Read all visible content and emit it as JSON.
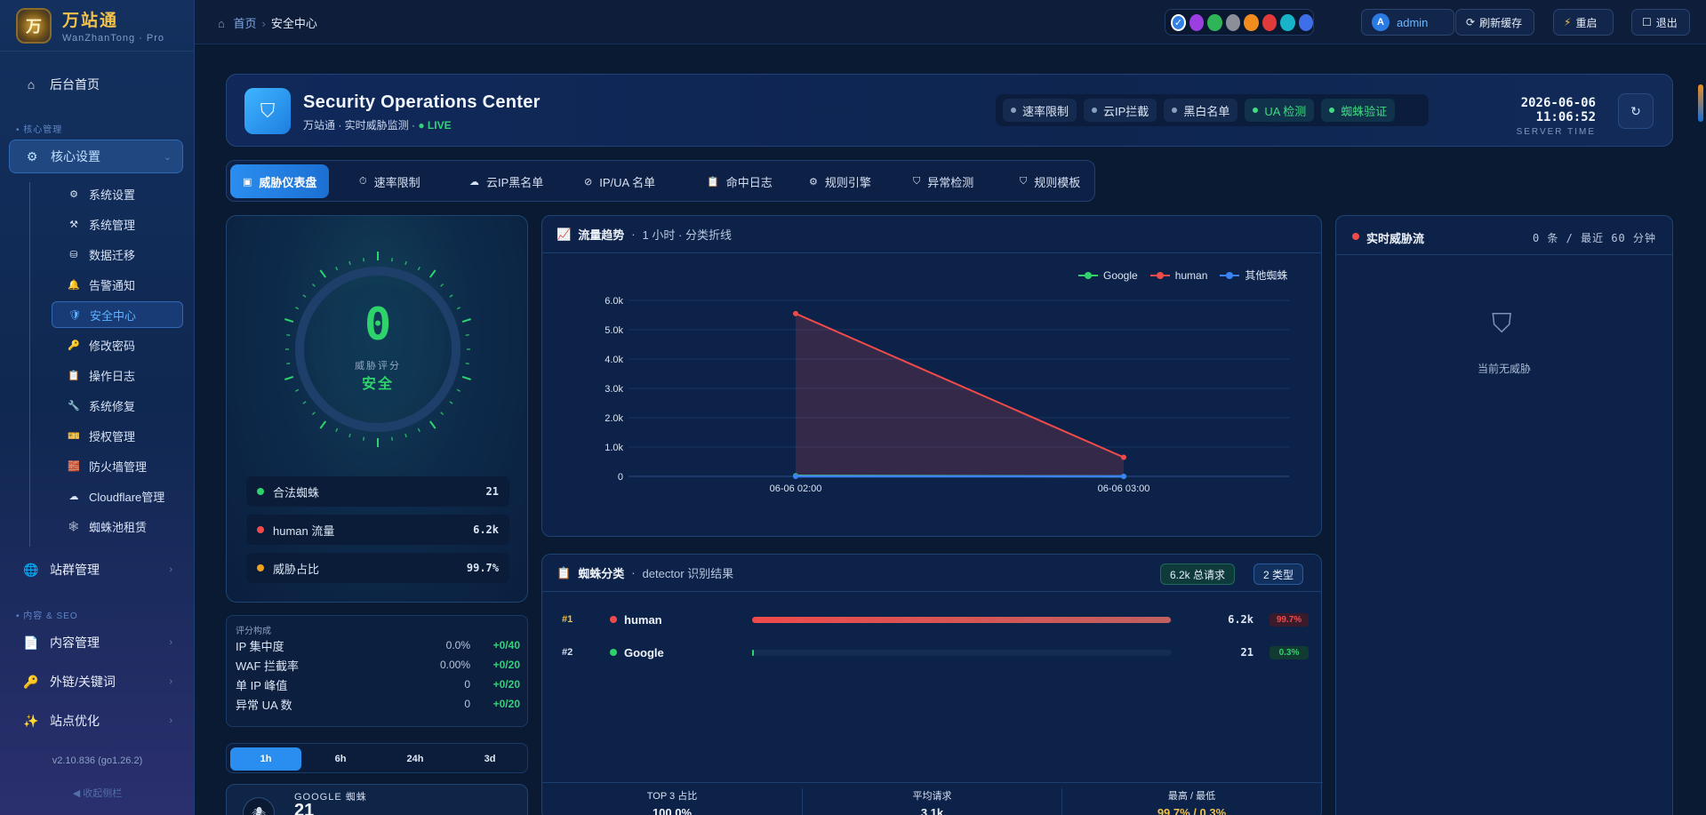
{
  "brand": {
    "logo_char": "万",
    "title": "万站通",
    "subtitle": "WanZhanTong · Pro"
  },
  "sidebar": {
    "home": "后台首页",
    "section_core": "核心管理",
    "core_settings": "核心设置",
    "sub_items": [
      "系统设置",
      "系统管理",
      "数据迁移",
      "告警通知",
      "安全中心",
      "修改密码",
      "操作日志",
      "系统修复",
      "授权管理",
      "防火墙管理",
      "Cloudflare管理",
      "蜘蛛池租赁"
    ],
    "site_mgmt": "站群管理",
    "section_content": "内容 & SEO",
    "content_mgmt": "内容管理",
    "links_keywords": "外链/关键词",
    "site_opt": "站点优化",
    "version": "v2.10.836 (go1.26.2)",
    "collapse": "◀ 收起侧栏"
  },
  "topbar": {
    "crumb_home": "首页",
    "crumb_sep": "›",
    "crumb_current": "安全中心",
    "theme_check": "✓",
    "theme_colors": [
      "#2f7fe5",
      "#9b3fe0",
      "#2fb558",
      "#8a8f9a",
      "#f08c1e",
      "#e03a3a",
      "#18b3c8",
      "#3f6fe8"
    ],
    "user_initial": "A",
    "user": "admin",
    "refresh_cache": "刷新缓存",
    "restart": "重启",
    "logout": "退出"
  },
  "header": {
    "title": "Security Operations Center",
    "subtitle": "万站通 · 实时威胁监测 · ",
    "live": "● LIVE",
    "chips": [
      {
        "label": "速率限制",
        "on": false
      },
      {
        "label": "云IP拦截",
        "on": false
      },
      {
        "label": "黑白名单",
        "on": false
      },
      {
        "label": "UA 检测",
        "on": true
      },
      {
        "label": "蜘蛛验证",
        "on": true
      }
    ],
    "datetime": "2026-06-06 11:06:52",
    "server_time": "SERVER TIME"
  },
  "tabs": [
    "威胁仪表盘",
    "速率限制",
    "云IP黑名单",
    "IP/UA 名单",
    "命中日志",
    "规则引擎",
    "异常检测",
    "规则模板"
  ],
  "score": {
    "value": "0",
    "label": "威胁评分",
    "state": "安全",
    "rows": [
      {
        "label": "合法蜘蛛",
        "value": "21",
        "color": "#2fd36b"
      },
      {
        "label": "human 流量",
        "value": "6.2k",
        "color": "#ef4b4b"
      },
      {
        "label": "威胁占比",
        "value": "99.7%",
        "color": "#f0a21e"
      }
    ]
  },
  "composition": {
    "title": "评分构成",
    "rows": [
      {
        "label": "IP 集中度",
        "value": "0.0%",
        "score": "+0/40"
      },
      {
        "label": "WAF 拦截率",
        "value": "0.00%",
        "score": "+0/20"
      },
      {
        "label": "单 IP 峰值",
        "value": "0",
        "score": "+0/20"
      },
      {
        "label": "异常 UA 数",
        "value": "0",
        "score": "+0/20"
      }
    ]
  },
  "ranges": [
    "1h",
    "6h",
    "24h",
    "3d"
  ],
  "google_card": {
    "label": "GOOGLE 蜘蛛",
    "value": "21"
  },
  "trend": {
    "title": "流量趋势",
    "subtitle": "1 小时 · 分类折线"
  },
  "chart_data": {
    "type": "line",
    "x": [
      "06-06 02:00",
      "06-06 03:00"
    ],
    "series": [
      {
        "name": "Google",
        "values": [
          21,
          0
        ],
        "color": "#2fd36b"
      },
      {
        "name": "human",
        "values": [
          5550,
          650
        ],
        "color": "#ef4b4b"
      },
      {
        "name": "其他蜘蛛",
        "values": [
          0,
          0
        ],
        "color": "#3b82f6"
      }
    ],
    "yticks": [
      "0",
      "1.0k",
      "2.0k",
      "3.0k",
      "4.0k",
      "5.0k",
      "6.0k"
    ],
    "ylim": [
      0,
      6000
    ],
    "grid": true,
    "legend": "top-right"
  },
  "spider": {
    "title": "蜘蛛分类",
    "subtitle": "detector 识别结果",
    "total_pill": "6.2k 总请求",
    "types_pill": "2 类型",
    "rows": [
      {
        "rank": "#1",
        "name": "human",
        "count": "6.2k",
        "pct": "99.7%",
        "fraction": 0.997,
        "color": "#ef4b4b"
      },
      {
        "rank": "#2",
        "name": "Google",
        "count": "21",
        "pct": "0.3%",
        "fraction": 0.003,
        "color": "#2fd36b"
      }
    ],
    "stats": [
      {
        "label": "TOP 3 占比",
        "value": "100.0%"
      },
      {
        "label": "平均请求",
        "value": "3.1k"
      },
      {
        "label": "最高 / 最低",
        "value": "99.7% / 0.3%"
      }
    ]
  },
  "live": {
    "title": "实时威胁流",
    "meta": "0 条 / 最近 60 分钟",
    "empty": "当前无威胁"
  }
}
